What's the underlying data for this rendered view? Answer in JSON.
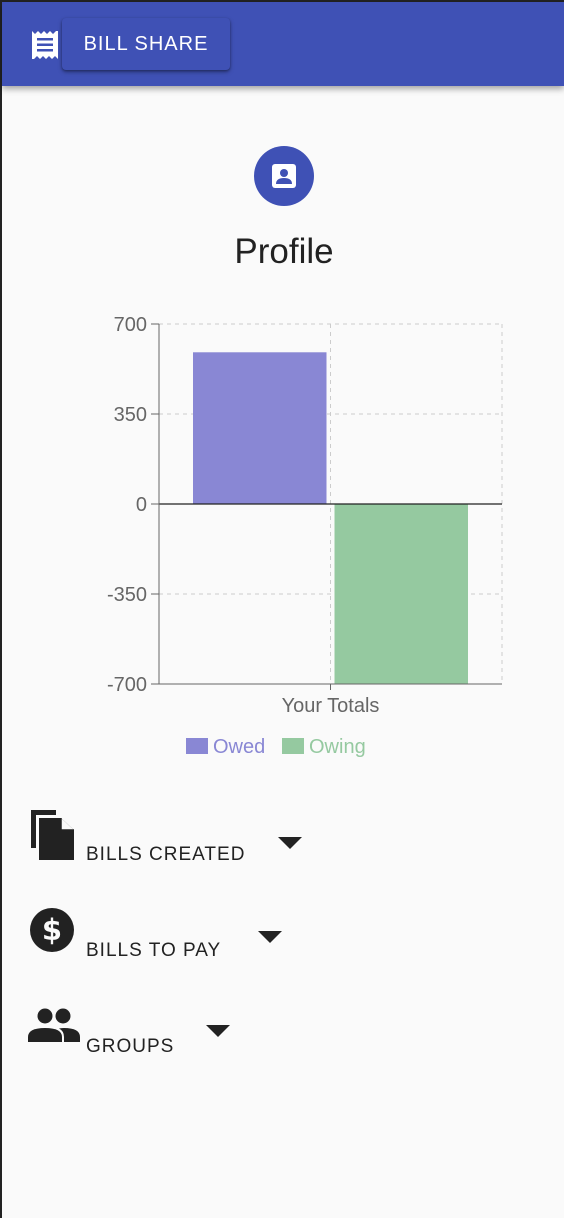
{
  "app": {
    "title": "BILL SHARE",
    "menu_icon": "receipt-icon",
    "accent_color": "#3f51b5"
  },
  "profile": {
    "title": "Profile",
    "icon": "contact-card-icon"
  },
  "chart_data": {
    "type": "bar",
    "categories": [
      "Your Totals"
    ],
    "series": [
      {
        "name": "Owed",
        "values": [
          590
        ],
        "color": "#8987d4"
      },
      {
        "name": "Owing",
        "values": [
          -700
        ],
        "color": "#95c9a0"
      }
    ],
    "ylim": [
      -700,
      700
    ],
    "yticks": [
      700,
      350,
      0,
      -350,
      -700
    ],
    "grid": true,
    "legend": "bottom"
  },
  "sections": [
    {
      "label": "BILLS CREATED",
      "icon": "file-copy-icon"
    },
    {
      "label": "BILLS TO PAY",
      "icon": "dollar-circle-icon"
    },
    {
      "label": "GROUPS",
      "icon": "people-icon"
    }
  ]
}
